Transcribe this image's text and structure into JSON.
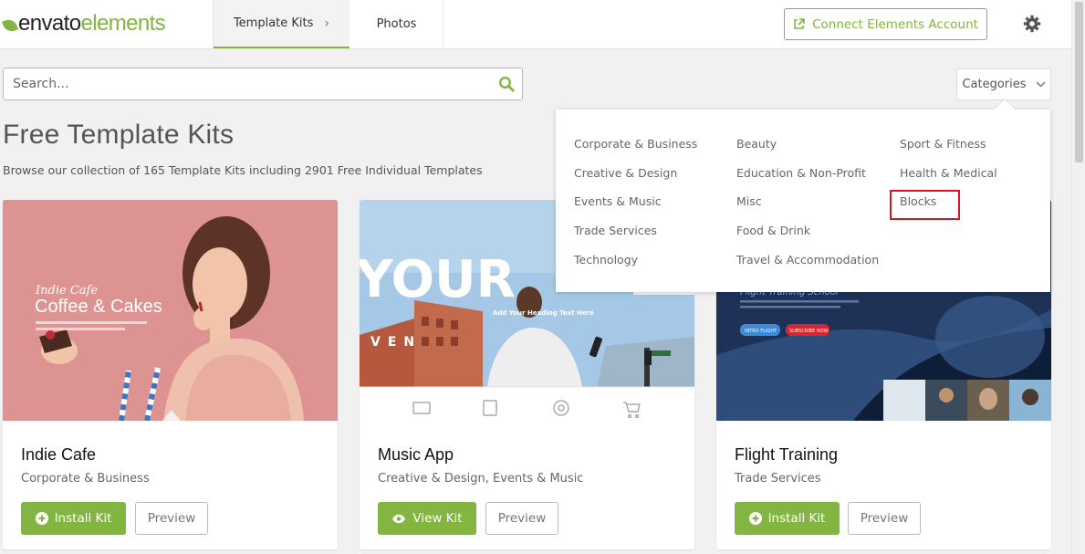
{
  "header": {
    "logo": {
      "part1": "envato",
      "part2": "elements"
    },
    "tabs": [
      {
        "label": "Template Kits",
        "active": true
      },
      {
        "label": "Photos",
        "active": false
      }
    ],
    "connect_button": "Connect Elements Account",
    "accent_color": "#82b541"
  },
  "search": {
    "placeholder": "Search...",
    "value": ""
  },
  "categories_button": "Categories",
  "page": {
    "title": "Free Template Kits",
    "subtitle": "Browse our collection of 165 Template Kits including 2901 Free Individual Templates"
  },
  "dropdown": {
    "columns": [
      [
        "Corporate & Business",
        "Creative & Design",
        "Events & Music",
        "Trade Services",
        "Technology"
      ],
      [
        "Beauty",
        "Education & Non-Profit",
        "Misc",
        "Food & Drink",
        "Travel & Accommodation"
      ],
      [
        "Sport & Fitness",
        "Health & Medical",
        "Blocks"
      ]
    ],
    "highlighted": "Blocks",
    "highlight_color": "#d7141f"
  },
  "cards": [
    {
      "name": "Indie Cafe",
      "categories": "Corporate & Business",
      "primary_button": "Install Kit",
      "primary_icon": "plus-circle-icon",
      "preview_button": "Preview",
      "thumb": {
        "script": "Indie Cafe",
        "headline": "Coffee & Cakes",
        "bg": "#dd8f8f"
      }
    },
    {
      "name": "Music App",
      "categories": "Creative & Design, Events & Music",
      "primary_button": "View Kit",
      "primary_icon": "eye-icon",
      "preview_button": "Preview",
      "thumb": {
        "big_text": "YOUR",
        "tag": "Add Your Heading Text Here",
        "banner": "VEN",
        "bg": "#9cc4e4"
      }
    },
    {
      "name": "Flight Training",
      "categories": "Trade Services",
      "primary_button": "Install Kit",
      "primary_icon": "plus-circle-icon",
      "preview_button": "Preview",
      "thumb": {
        "heading": "Flight Training School",
        "btn1": "INTRO FLIGHT",
        "btn2": "SUBSCRIBE NOW",
        "bg": "#243a63"
      }
    }
  ]
}
